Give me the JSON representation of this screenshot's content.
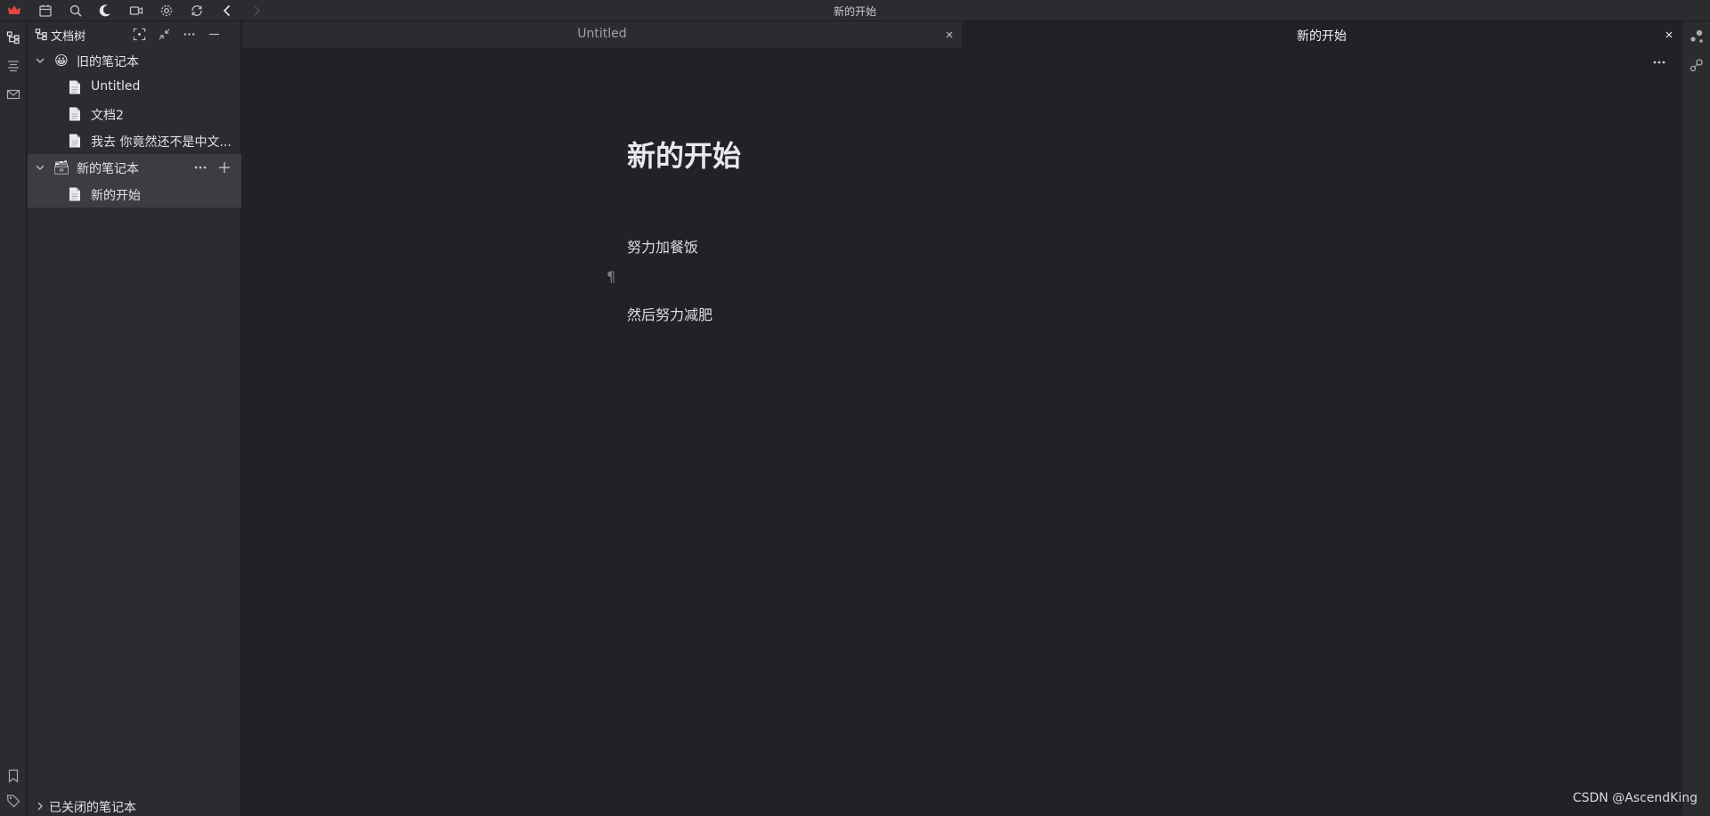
{
  "window": {
    "title": "新的开始"
  },
  "topbar": {
    "icons": [
      "crown-logo-icon",
      "calendar-icon",
      "search-icon",
      "moon-icon",
      "video-icon",
      "gear-icon",
      "sync-icon",
      "back-arrow-icon",
      "forward-arrow-icon"
    ]
  },
  "activitybar": {
    "icons": [
      "file-tree-icon",
      "outline-icon",
      "inbox-icon",
      "bookmark-icon",
      "tag-icon"
    ]
  },
  "filetree": {
    "title": "文档树",
    "notebooks": [
      {
        "emoji": "😀",
        "name": "旧的笔记本",
        "docs": [
          "Untitled",
          "文档2",
          "我去 你竟然还不是中文..."
        ]
      },
      {
        "emoji": "🗃",
        "name": "新的笔记本",
        "docs": [
          "新的开始"
        ]
      }
    ],
    "closed_notebooks_label": "已关闭的笔记本"
  },
  "tabs": [
    {
      "label": "Untitled",
      "active": false
    },
    {
      "label": "新的开始",
      "active": true
    }
  ],
  "document": {
    "title": "新的开始",
    "paragraphs": [
      "努力加餐饭",
      "",
      "然后努力减肥"
    ],
    "empty_block_marker": "¶"
  },
  "watermark": "CSDN @AscendKing",
  "colors": {
    "background": "#212226",
    "panel": "#2b2c30",
    "selected_row": "#3c3d41",
    "logo_red": "#e0483e"
  }
}
